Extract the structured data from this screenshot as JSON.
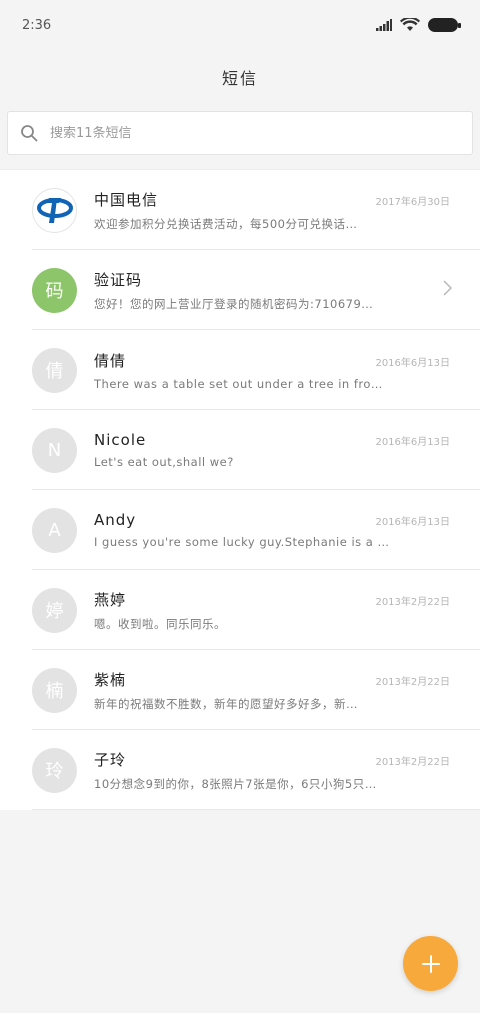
{
  "status_bar": {
    "time": "2:36"
  },
  "header": {
    "title": "短信"
  },
  "search": {
    "placeholder": "搜索11条短信"
  },
  "messages": [
    {
      "name": "中国电信",
      "date": "2017年6月30日",
      "preview": "欢迎参加积分兑换话费活动，每500分可兑换话…",
      "avatar": "",
      "avatar_type": "logo"
    },
    {
      "name": "验证码",
      "date": "",
      "preview": "您好！您的网上营业厅登录的随机密码为:710679…",
      "avatar": "码",
      "avatar_type": "green"
    },
    {
      "name": "倩倩",
      "date": "2016年6月13日",
      "preview": "There was a table set out under a tree in fro…",
      "avatar": "倩",
      "avatar_type": "gray"
    },
    {
      "name": "Nicole",
      "date": "2016年6月13日",
      "preview": "Let's eat out,shall we?",
      "avatar": "N",
      "avatar_type": "gray"
    },
    {
      "name": "Andy",
      "date": "2016年6月13日",
      "preview": "I guess you're some lucky guy.Stephanie is a …",
      "avatar": "A",
      "avatar_type": "gray"
    },
    {
      "name": "燕婷",
      "date": "2013年2月22日",
      "preview": "嗯。收到啦。同乐同乐。",
      "avatar": "婷",
      "avatar_type": "gray"
    },
    {
      "name": "紫楠",
      "date": "2013年2月22日",
      "preview": "新年的祝福数不胜数，新年的愿望好多好多，新…",
      "avatar": "楠",
      "avatar_type": "gray"
    },
    {
      "name": "子玲",
      "date": "2013年2月22日",
      "preview": "10分想念9到的你，8张照片7张是你，6只小狗5只…",
      "avatar": "玲",
      "avatar_type": "gray"
    }
  ],
  "colors": {
    "accent": "#f8a93c",
    "verify_green": "#8cc56a",
    "telecom_blue": "#1163b5"
  }
}
